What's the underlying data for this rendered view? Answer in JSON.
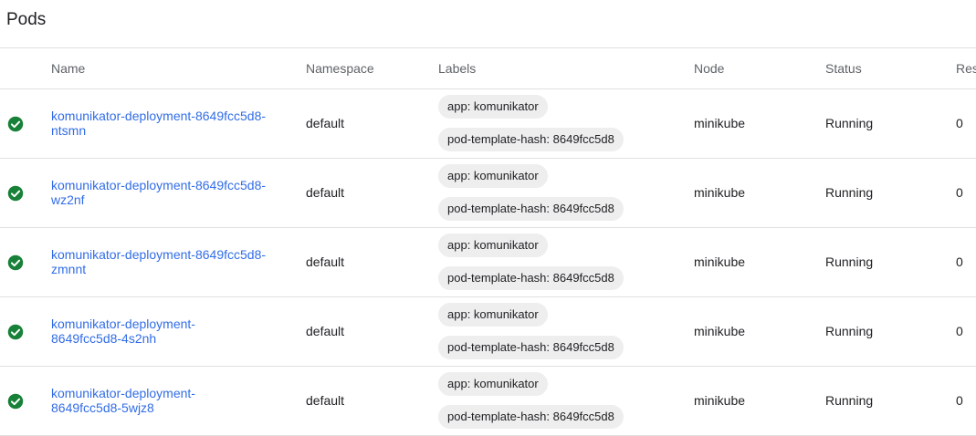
{
  "page": {
    "title": "Pods"
  },
  "table": {
    "columns": {
      "name": "Name",
      "namespace": "Namespace",
      "labels": "Labels",
      "node": "Node",
      "status": "Status",
      "restarts": "Res"
    },
    "rows": [
      {
        "name_line1": "komunikator-deployment-8649fcc5d8-",
        "name_line2": "ntsmn",
        "namespace": "default",
        "label1": "app: komunikator",
        "label2": "pod-template-hash: 8649fcc5d8",
        "node": "minikube",
        "status": "Running",
        "restarts": "0"
      },
      {
        "name_line1": "komunikator-deployment-8649fcc5d8-",
        "name_line2": "wz2nf",
        "namespace": "default",
        "label1": "app: komunikator",
        "label2": "pod-template-hash: 8649fcc5d8",
        "node": "minikube",
        "status": "Running",
        "restarts": "0"
      },
      {
        "name_line1": "komunikator-deployment-8649fcc5d8-",
        "name_line2": "zmnnt",
        "namespace": "default",
        "label1": "app: komunikator",
        "label2": "pod-template-hash: 8649fcc5d8",
        "node": "minikube",
        "status": "Running",
        "restarts": "0"
      },
      {
        "name_line1": "komunikator-deployment-",
        "name_line2": "8649fcc5d8-4s2nh",
        "namespace": "default",
        "label1": "app: komunikator",
        "label2": "pod-template-hash: 8649fcc5d8",
        "node": "minikube",
        "status": "Running",
        "restarts": "0"
      },
      {
        "name_line1": "komunikator-deployment-",
        "name_line2": "8649fcc5d8-5wjz8",
        "namespace": "default",
        "label1": "app: komunikator",
        "label2": "pod-template-hash: 8649fcc5d8",
        "node": "minikube",
        "status": "Running",
        "restarts": "0"
      }
    ]
  },
  "icons": {
    "status": "check-circle-icon"
  },
  "colors": {
    "running": "#188038",
    "link": "#326de6",
    "chip": "#eeeeee"
  }
}
